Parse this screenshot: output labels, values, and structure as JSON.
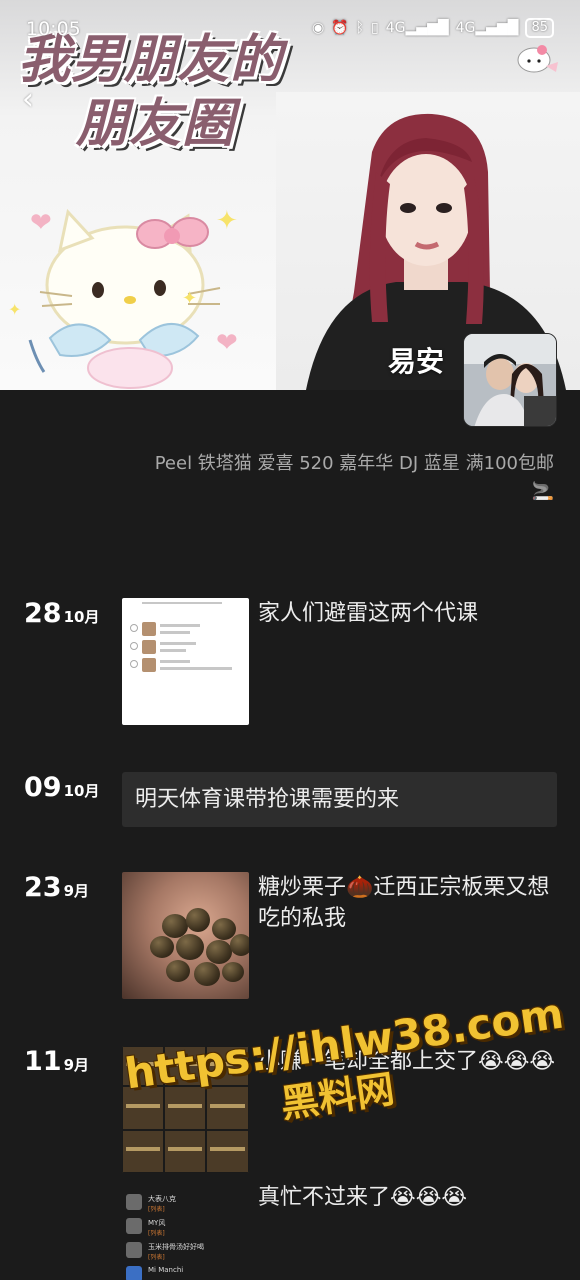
{
  "status_bar": {
    "time": "10:05",
    "icons": [
      "eye-icon",
      "alarm-icon",
      "bluetooth-icon",
      "vibrate-icon",
      "signal-4g-icon",
      "signal-4g-icon"
    ],
    "network_1": "4G",
    "network_2": "4G",
    "battery": "85"
  },
  "cover": {
    "title_line1": "我男朋友的",
    "title_line2": "朋友圈",
    "username": "易安"
  },
  "profile": {
    "signature": "Peel 铁塔猫 爱喜 520 嘉年华 DJ 蓝星 满100包邮🚬"
  },
  "posts": [
    {
      "day": "28",
      "month": "10月",
      "text": "家人们避雷这两个代课",
      "kind": "screenshot"
    },
    {
      "day": "09",
      "month": "10月",
      "text": "明天体育课带抢课需要的来",
      "kind": "text"
    },
    {
      "day": "23",
      "month": "9月",
      "text": "糖炒栗子🌰迁西正宗板栗又想吃的私我",
      "kind": "photo"
    },
    {
      "day": "11",
      "month": "9月",
      "text": "小赚一笔却全都上交了😭😭😭",
      "text2": "真忙不过来了😭😭😭",
      "kind": "collage"
    }
  ],
  "collage_list": [
    {
      "name": "大表八克",
      "sub": "[列表]"
    },
    {
      "name": "MY风",
      "sub": "[列表]"
    },
    {
      "name": "玉米排骨汤好好喝",
      "sub": "[列表]"
    },
    {
      "name": "Mi Manchi",
      "sub": ""
    }
  ],
  "watermark": {
    "url": "https://ihlw38.com",
    "name": "黑料网"
  }
}
